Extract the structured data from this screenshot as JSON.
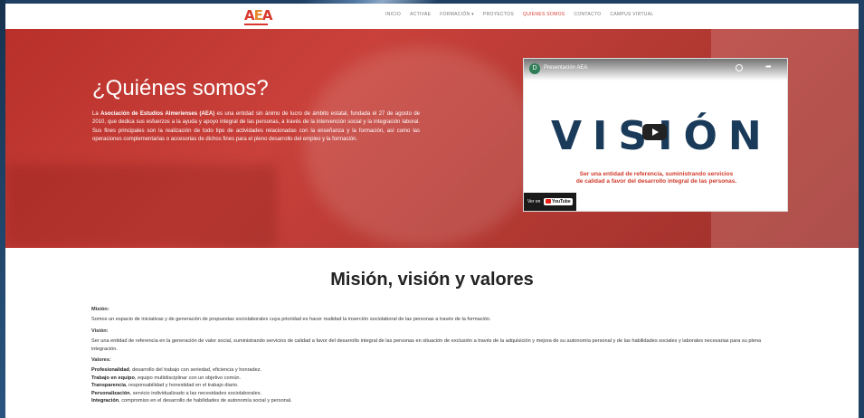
{
  "brand": {
    "logo_text": "AEA"
  },
  "nav": {
    "items": [
      {
        "label": "INICIO"
      },
      {
        "label": "ACTIVAE"
      },
      {
        "label": "FORMACIÓN ▾"
      },
      {
        "label": "PROYECTOS"
      },
      {
        "label": "QUIENES SOMOS"
      },
      {
        "label": "CONTACTO"
      },
      {
        "label": "CAMPUS VIRTUAL"
      }
    ],
    "active": "QUIENES SOMOS"
  },
  "hero": {
    "title": "¿Quiénes somos?",
    "intro_bold": "Asociación de Estudios Almerienses (AEA)",
    "intro_prefix": "La ",
    "intro_rest": " es una entidad sin ánimo de lucro de ámbito estatal, fundada el 27 de agosto de 2010, que dedica sus esfuerzos a la ayuda y apoyo integral de las personas, a través de la intervención social y la integración laboral. Sus fines principales son la realización de todo tipo de actividades relacionadas con la enseñanza y la formación, así como las operaciones complementarias o accesorias de dichos fines para el pleno desarrollo del empleo y la formación."
  },
  "video": {
    "channel_initial": "D",
    "title": "Presentación AEA",
    "thumbnail_word": "VISIÓN",
    "caption_line1": "Ser una entidad de referencia, suministrando servicios",
    "caption_line2": "de calidad a favor del desarrollo integral de las personas.",
    "watch_on": "Ver en",
    "platform": "YouTube"
  },
  "section": {
    "title": "Misión, visión y valores",
    "mision_heading": "Misión:",
    "mision_text": "Somos un espacio de iniciativas y de generación de propuestas sociolaborales cuya prioridad es hacer realidad la inserción sociolaboral de las personas a través de la formación.",
    "vision_heading": "Visión:",
    "vision_text": "Ser una entidad de referencia en la generación de valor social, suministrando servicios de calidad a favor del desarrollo integral de las personas en situación de exclusión a través de la adquisición y mejora de su autonomía personal y de las habilidades sociales y laborales necesarias para su plena integración.",
    "valores_heading": "Valores:",
    "valores": [
      {
        "name": "Profesionalidad",
        "desc": ", desarrollo del trabajo con seriedad, eficiencia y honradez."
      },
      {
        "name": "Trabajo en equipo",
        "desc": ", equipo multidisciplinar con un objetivo común."
      },
      {
        "name": "Transparencia",
        "desc": ", responsabilidad y honestidad en el trabajo diario."
      },
      {
        "name": "Personalización",
        "desc": ", servicio individualizado a las necesidades sociolaborales."
      },
      {
        "name": "Integración",
        "desc": ", compromiso en el desarrollo de habilidades de autonomía social y personal."
      }
    ]
  },
  "colors": {
    "accent": "#d7392e",
    "hero": "#c9413a",
    "frame": "#1f3f63"
  }
}
